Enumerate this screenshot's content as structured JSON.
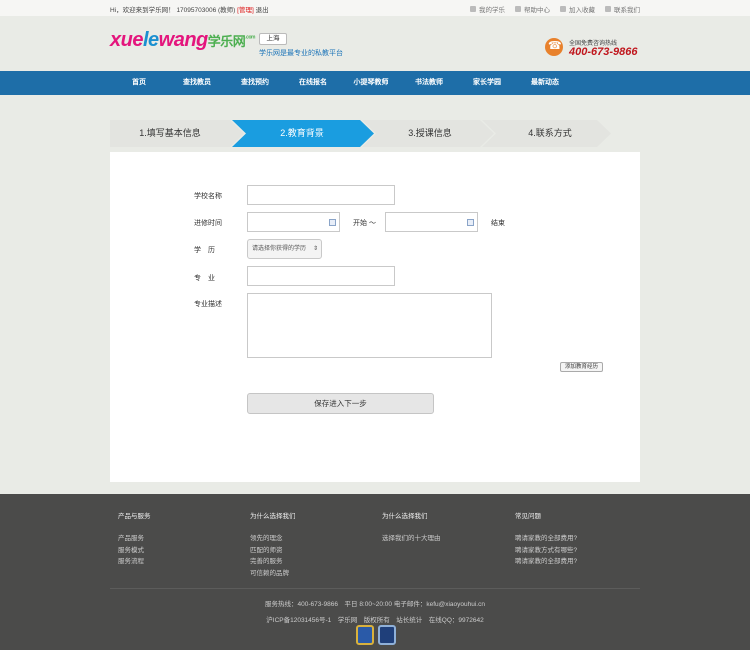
{
  "topbar": {
    "greeting": "Hi，欢迎来到学乐网！ 17095703006 (教师)",
    "admin_label": "[管理]",
    "logout_label": "退出",
    "links": [
      "我的学乐",
      "帮助中心",
      "加入收藏",
      "联系我们"
    ]
  },
  "header": {
    "logo_part1": "xue",
    "logo_part2": "le",
    "logo_part3": "wang",
    "logo_cn": "学乐网",
    "logo_com": ".com",
    "city": "上海",
    "slogan": "学乐网是最专业的私教平台",
    "hotline_label": "全国免费咨询热线",
    "hotline_number": "400-673-9866"
  },
  "nav": {
    "items": [
      "首页",
      "查找教员",
      "查找预约",
      "在线报名",
      "小提琴教师",
      "书法教师",
      "家长学园",
      "最新动态"
    ]
  },
  "steps": {
    "items": [
      "1.填写基本信息",
      "2.教育背景",
      "3.授课信息",
      "4.联系方式"
    ],
    "active_index": 1,
    "colors": {
      "active": "#1a9de0",
      "inactive": "#e3e4e0"
    }
  },
  "form": {
    "school_label": "学校名称",
    "period_label": "进修时间",
    "start_label": "开始 ～",
    "end_label": "结束",
    "degree_label": "学　历",
    "degree_placeholder": "请选择你获得的学历",
    "major_label": "专　业",
    "desc_label": "专业描述",
    "add_button": "添加教育经历",
    "save_button": "保存进入下一步"
  },
  "footer": {
    "columns": [
      {
        "title": "产品与服务",
        "items": [
          "产品服务",
          "服务模式",
          "服务流程"
        ]
      },
      {
        "title": "为什么选择我们",
        "items": [
          "领先的理念",
          "匹配的师资",
          "完善的服务",
          "可信赖的品牌"
        ]
      },
      {
        "title": "为什么选择我们",
        "items": [
          "选择我们的十大理由"
        ]
      },
      {
        "title": "常见问题",
        "items": [
          "聘请家教的全部费用?",
          "聘请家教方式有哪些?",
          "聘请家教的全部费用?"
        ]
      }
    ],
    "line1": "服务热线：400-673-9866　平日 8:00~20:00 电子邮件：kefu@xiaoyouhui.cn",
    "line2": "沪ICP备12031456号-1　学乐网　版权所有　站长统计　在线QQ：9972642"
  }
}
